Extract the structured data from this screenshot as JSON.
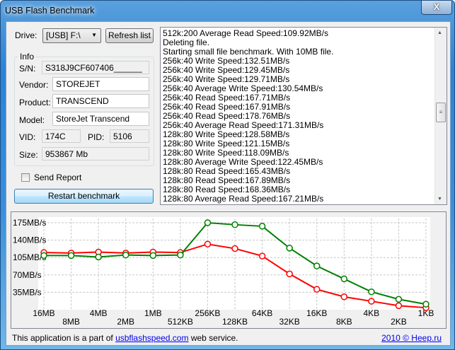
{
  "window": {
    "title": "USB Flash Benchmark",
    "close_label": "X"
  },
  "drive": {
    "label": "Drive:",
    "selected": "[USB] F:\\",
    "refresh_label": "Refresh list"
  },
  "info": {
    "group_label": "Info",
    "sn_label": "S/N:",
    "sn": "S318J9CF607406______",
    "vendor_label": "Vendor:",
    "vendor": "STOREJET",
    "product_label": "Product:",
    "product": "TRANSCEND",
    "model_label": "Model:",
    "model": "StoreJet Transcend",
    "vid_label": "VID:",
    "vid": "174C",
    "pid_label": "PID:",
    "pid": "5106",
    "size_label": "Size:",
    "size": "953867 Mb"
  },
  "send_report": {
    "label": "Send Report",
    "checked": false
  },
  "restart_label": "Restart benchmark",
  "log": [
    "512k:200 Average Read Speed:109.92MB/s",
    "Deleting file.",
    "Starting small file benchmark. With 10MB file.",
    "256k:40 Write Speed:132.51MB/s",
    "256k:40 Write Speed:129.45MB/s",
    "256k:40 Write Speed:129.71MB/s",
    "256k:40 Average Write Speed:130.54MB/s",
    "256k:40 Read Speed:167.71MB/s",
    "256k:40 Read Speed:167.91MB/s",
    "256k:40 Read Speed:178.76MB/s",
    "256k:40 Average Read Speed:171.31MB/s",
    "128k:80 Write Speed:128.58MB/s",
    "128k:80 Write Speed:121.15MB/s",
    "128k:80 Write Speed:118.09MB/s",
    "128k:80 Average Write Speed:122.45MB/s",
    "128k:80 Read Speed:165.43MB/s",
    "128k:80 Read Speed:167.89MB/s",
    "128k:80 Read Speed:168.36MB/s",
    "128k:80 Average Read Speed:167.21MB/s"
  ],
  "footer": {
    "prefix": "This application is a part of ",
    "link": "usbflashspeed.com",
    "suffix": " web service.",
    "copyright": "2010 © Heep.ru"
  },
  "chart_data": {
    "type": "line",
    "categories": [
      "16MB",
      "8MB",
      "4MB",
      "2MB",
      "1MB",
      "512KB",
      "256KB",
      "128KB",
      "64KB",
      "32KB",
      "16KB",
      "8KB",
      "4KB",
      "2KB",
      "1KB"
    ],
    "ylim": [
      0,
      175
    ],
    "yticks": [
      35,
      70,
      105,
      140,
      175
    ],
    "ytick_labels": [
      "35MB/s",
      "70MB/s",
      "105MB/s",
      "140MB/s",
      "175MB/s"
    ],
    "grid": true,
    "series": [
      {
        "color": "#ff0000",
        "values": [
          115,
          114,
          116,
          114,
          116,
          115,
          132,
          123,
          108,
          72,
          41,
          26,
          17,
          8,
          4
        ]
      },
      {
        "color": "#008000",
        "values": [
          109,
          109,
          106,
          110,
          109,
          110,
          175,
          171,
          168,
          124,
          88,
          62,
          36,
          21,
          11
        ]
      }
    ]
  }
}
